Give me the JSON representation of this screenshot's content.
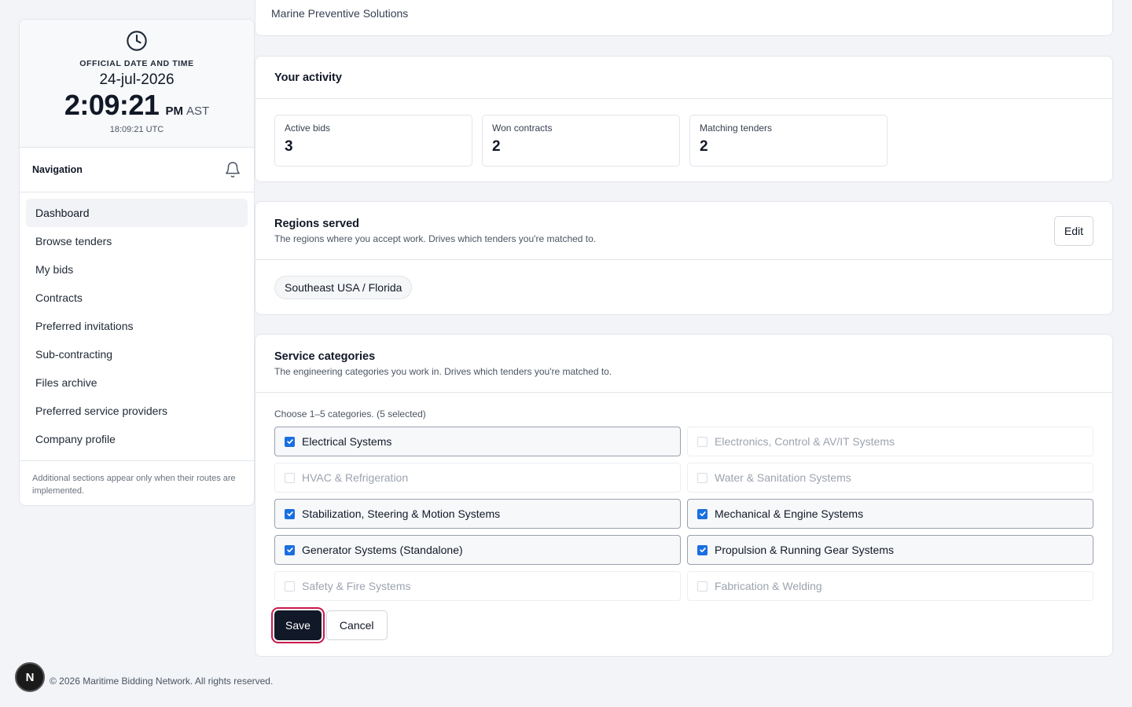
{
  "clock": {
    "caption": "OFFICIAL DATE AND TIME",
    "date": "24-jul-2026",
    "time": "2:09:21",
    "ampm": "PM",
    "zone": "AST",
    "utc": "18:09:21 UTC"
  },
  "nav": {
    "title": "Navigation",
    "items": [
      {
        "label": "Dashboard"
      },
      {
        "label": "Browse tenders"
      },
      {
        "label": "My bids"
      },
      {
        "label": "Contracts"
      },
      {
        "label": "Preferred invitations"
      },
      {
        "label": "Sub-contracting"
      },
      {
        "label": "Files archive"
      },
      {
        "label": "Preferred service providers"
      },
      {
        "label": "Company profile"
      }
    ],
    "note": "Additional sections appear only when their routes are implemented."
  },
  "company": {
    "name": "Marine Preventive Solutions"
  },
  "activity": {
    "title": "Your activity",
    "stats": [
      {
        "label": "Active bids",
        "value": "3"
      },
      {
        "label": "Won contracts",
        "value": "2"
      },
      {
        "label": "Matching tenders",
        "value": "2"
      }
    ]
  },
  "regions": {
    "title": "Regions served",
    "subtitle": "The regions where you accept work. Drives which tenders you're matched to.",
    "edit_label": "Edit",
    "chips": [
      "Southeast USA / Florida"
    ]
  },
  "categories": {
    "title": "Service categories",
    "subtitle": "The engineering categories you work in. Drives which tenders you're matched to.",
    "hint": "Choose 1–5 categories. (5 selected)",
    "items": [
      {
        "label": "Electrical Systems",
        "selected": true
      },
      {
        "label": "Electronics, Control & AV/IT Systems",
        "selected": false
      },
      {
        "label": "HVAC & Refrigeration",
        "selected": false
      },
      {
        "label": "Water & Sanitation Systems",
        "selected": false
      },
      {
        "label": "Stabilization, Steering & Motion Systems",
        "selected": true
      },
      {
        "label": "Mechanical & Engine Systems",
        "selected": true
      },
      {
        "label": "Generator Systems (Standalone)",
        "selected": true
      },
      {
        "label": "Propulsion & Running Gear Systems",
        "selected": true
      },
      {
        "label": "Safety & Fire Systems",
        "selected": false
      },
      {
        "label": "Fabrication & Welding",
        "selected": false
      }
    ],
    "save_label": "Save",
    "cancel_label": "Cancel"
  },
  "footer": {
    "text": "© 2026 Maritime Bidding Network. All rights reserved."
  },
  "badge": {
    "letter": "N"
  },
  "icons": {
    "clock": "clock-icon",
    "bell": "bell-icon",
    "check": "check-icon"
  },
  "colors": {
    "primary": "#111827",
    "checkbox": "#1a6fe0",
    "focus_ring": "#c8194b"
  }
}
